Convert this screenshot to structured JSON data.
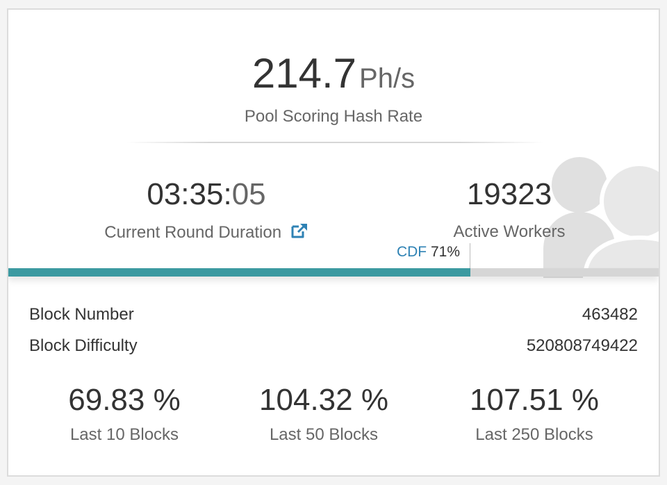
{
  "hashrate": {
    "value": "214.7",
    "unit": "Ph/s",
    "label": "Pool Scoring Hash Rate"
  },
  "round": {
    "duration_main": "03:35:",
    "duration_seconds": "05",
    "label": "Current Round Duration",
    "link_icon": "external-link-icon"
  },
  "workers": {
    "value": "19323",
    "label": "Active Workers",
    "background_icon": "users-icon"
  },
  "cdf": {
    "key": "CDF",
    "value": "71%",
    "fraction": 0.71
  },
  "block": {
    "number_label": "Block Number",
    "number_value": "463482",
    "difficulty_label": "Block Difficulty",
    "difficulty_value": "520808749422"
  },
  "luck": [
    {
      "value": "69.83 %",
      "label": "Last 10 Blocks"
    },
    {
      "value": "104.32 %",
      "label": "Last 50 Blocks"
    },
    {
      "value": "107.51 %",
      "label": "Last 250 Blocks"
    }
  ],
  "colors": {
    "progress_fill": "#3c9aa1",
    "progress_track": "#d6d6d6",
    "cdf_accent": "#2e82b4"
  }
}
